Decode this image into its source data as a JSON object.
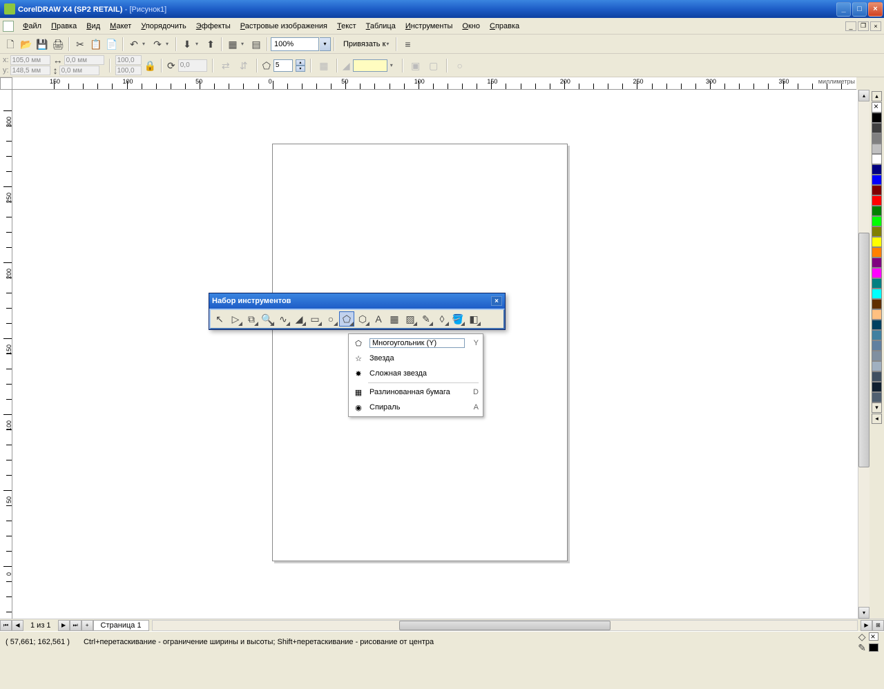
{
  "title": {
    "app": "CorelDRAW X4 (SP2 RETAIL)",
    "doc": "[Рисунок1]"
  },
  "menu": [
    "Файл",
    "Правка",
    "Вид",
    "Макет",
    "Упорядочить",
    "Эффекты",
    "Растровые изображения",
    "Текст",
    "Таблица",
    "Инструменты",
    "Окно",
    "Справка"
  ],
  "toolbar1": {
    "zoom": "100%",
    "snap_label": "Привязать к"
  },
  "propbar": {
    "x_label": "x:",
    "x_val": "105,0 мм",
    "y_label": "y:",
    "y_val": "148,5 мм",
    "w_val": "0,0 мм",
    "h_val": "0,0 мм",
    "sx": "100,0",
    "sy": "100,0",
    "rot": "0,0",
    "sides": "5"
  },
  "ruler_units": "миллиметры",
  "ruler_h": [
    "150",
    "100",
    "50",
    "0",
    "50",
    "100",
    "150",
    "200",
    "250",
    "300",
    "350"
  ],
  "ruler_v": [
    "300",
    "250",
    "200",
    "150",
    "100",
    "50",
    "0"
  ],
  "toolbox": {
    "title": "Набор инструментов"
  },
  "flyout": [
    {
      "label": "Многоугольник (Y)",
      "key": "Y",
      "active": true
    },
    {
      "label": "Звезда",
      "key": ""
    },
    {
      "label": "Сложная звезда",
      "key": ""
    },
    {
      "sep": true
    },
    {
      "label": "Разлинованная бумага",
      "key": "D"
    },
    {
      "label": "Спираль",
      "key": "A"
    }
  ],
  "page_nav": {
    "count": "1 из 1",
    "tab": "Страница 1"
  },
  "status": {
    "coords": "( 57,661; 162,561 )",
    "hint": "Ctrl+перетаскивание - ограничение ширины и высоты; Shift+перетаскивание - рисование от центра"
  },
  "palette": [
    "#000000",
    "#404040",
    "#808080",
    "#c0c0c0",
    "#ffffff",
    "#000080",
    "#0000ff",
    "#800000",
    "#ff0000",
    "#008000",
    "#00ff00",
    "#808000",
    "#ffff00",
    "#ff8000",
    "#800080",
    "#ff00ff",
    "#008080",
    "#00ffff",
    "#603000",
    "#ffc080",
    "#004060",
    "#4080a0",
    "#6080a0",
    "#8090a0",
    "#a0b0c0",
    "#405060",
    "#102030",
    "#506070"
  ]
}
